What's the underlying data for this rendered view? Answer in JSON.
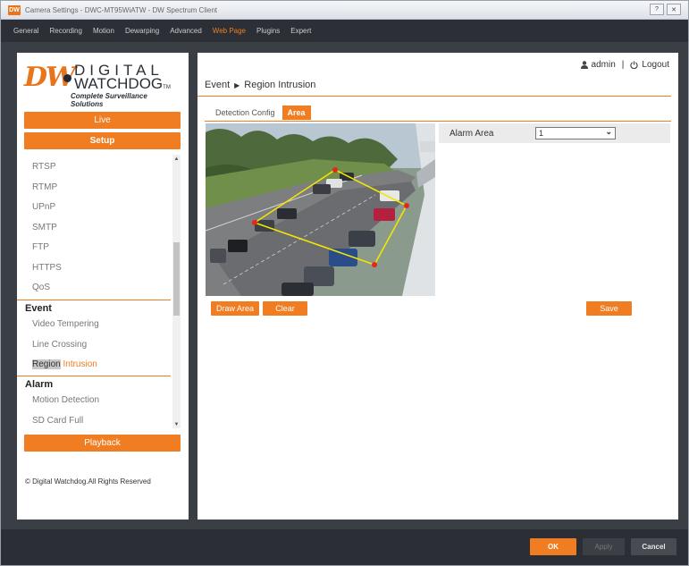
{
  "window": {
    "badge": "DW",
    "title": "Camera Settings - DWC-MT95WiATW - DW Spectrum Client",
    "help_glyph": "?",
    "close_glyph": "✕"
  },
  "menubar": {
    "items": [
      "General",
      "Recording",
      "Motion",
      "Dewarping",
      "Advanced",
      "Web Page",
      "Plugins",
      "Expert"
    ],
    "active": "Web Page"
  },
  "logo": {
    "mark": "DW",
    "line1": "DIGITAL",
    "line2": "WATCHDOG",
    "tm": "TM",
    "tagline": "Complete Surveillance Solutions"
  },
  "sidebar": {
    "live_label": "Live",
    "setup_label": "Setup",
    "playback_label": "Playback",
    "network_items": [
      "RTSP",
      "RTMP",
      "UPnP",
      "SMTP",
      "FTP",
      "HTTPS",
      "QoS"
    ],
    "event_heading": "Event",
    "event_items": [
      "Video Tempering",
      "Line Crossing"
    ],
    "selected_item_part1": "Region",
    "selected_item_part2": "Intrusion",
    "alarm_heading": "Alarm",
    "alarm_items": [
      "Motion Detection",
      "SD Card Full"
    ],
    "scroll_up": "▲",
    "scroll_down": "▼",
    "copyright": "© Digital Watchdog.All Rights Reserved"
  },
  "header": {
    "user_icon": "user-icon",
    "username": "admin",
    "separator": "|",
    "logout_icon": "power-icon",
    "logout_label": "Logout",
    "breadcrumb_parent": "Event",
    "breadcrumb_arrow": "▶",
    "breadcrumb_current": "Region Intrusion"
  },
  "tabs": [
    {
      "label": "Detection Config",
      "active": false
    },
    {
      "label": "Area",
      "active": true
    }
  ],
  "alarm_area": {
    "label": "Alarm Area",
    "value": "1",
    "chevron": "⌄"
  },
  "actions": {
    "draw_area": "Draw Area",
    "clear": "Clear",
    "save": "Save"
  },
  "footer": {
    "ok": "OK",
    "apply": "Apply",
    "cancel": "Cancel"
  },
  "colors": {
    "accent": "#f07d21",
    "dark": "#2c3036",
    "zone_line": "#f2e600",
    "zone_point": "#e5261c"
  }
}
